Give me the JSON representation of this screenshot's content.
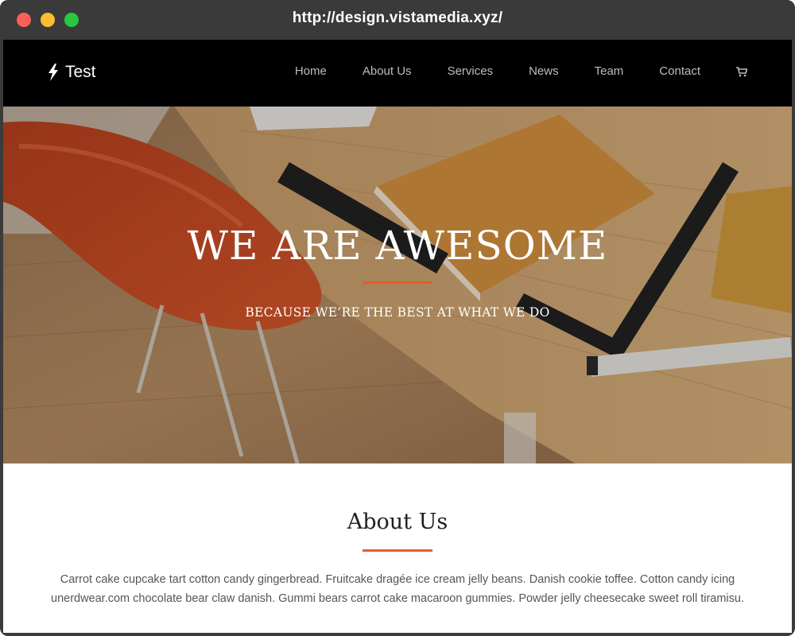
{
  "browser": {
    "url": "http://design.vistamedia.xyz/"
  },
  "navbar": {
    "brand": "Test",
    "brand_icon": "bolt-icon",
    "items": [
      {
        "label": "Home"
      },
      {
        "label": "About Us"
      },
      {
        "label": "Services"
      },
      {
        "label": "News"
      },
      {
        "label": "Team"
      },
      {
        "label": "Contact"
      }
    ],
    "cart_icon": "cart-icon"
  },
  "hero": {
    "title": "WE ARE AWESOME",
    "subtitle": "BECAUSE WE’RE THE BEST AT WHAT WE DO"
  },
  "about": {
    "title": "About Us",
    "text": "Carrot cake cupcake tart cotton candy gingerbread. Fruitcake dragée ice cream jelly beans. Danish cookie toffee. Cotton candy icing unerdwear.com chocolate bear claw danish. Gummi bears carrot cake macaroon gummies. Powder jelly cheesecake sweet roll tiramisu."
  },
  "colors": {
    "accent": "#e85a2c",
    "navbar_bg": "#000000",
    "nav_text": "#bdbdbd"
  }
}
